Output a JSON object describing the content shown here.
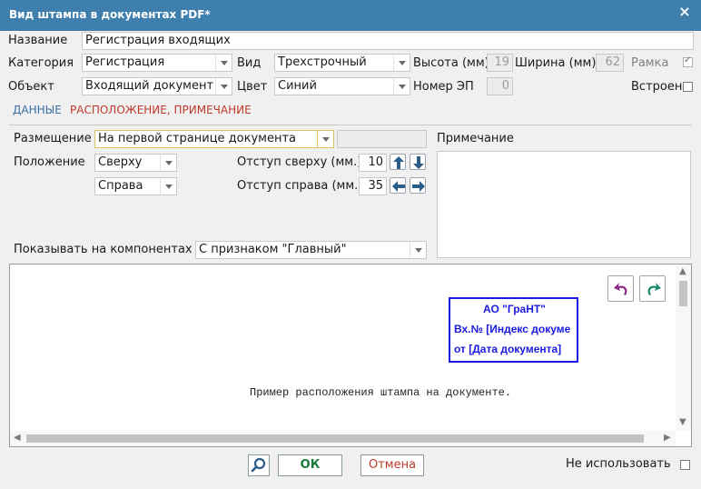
{
  "window": {
    "title": "Вид штампа в документах PDF*",
    "close_label": "×"
  },
  "fields": {
    "name_label": "Название",
    "name_value": "Регистрация входящих",
    "category_label": "Категория",
    "category_value": "Регистрация",
    "view_label": "Вид",
    "view_value": "Трехстрочный",
    "height_label": "Высота (мм)",
    "height_value": "19",
    "width_label": "Ширина (мм)",
    "width_value": "62",
    "frame_label": "Рамка",
    "frame_checked": true,
    "object_label": "Объект",
    "object_value": "Входящий документ",
    "color_label": "Цвет",
    "color_value": "Синий",
    "ep_label": "Номер ЭП",
    "ep_value": "0",
    "embedded_label": "Встроен",
    "embedded_checked": false
  },
  "tabs": [
    {
      "label": "ДАННЫЕ",
      "active": false
    },
    {
      "label": "РАСПОЛОЖЕНИЕ, ПРИМЕЧАНИЕ",
      "active": true
    }
  ],
  "placement": {
    "placement_label": "Размещение",
    "placement_value": "На первой странице документа",
    "position_label": "Положение",
    "vertical_value": "Сверху",
    "horizontal_value": "Справа",
    "offset_top_label": "Отступ сверху (мм.)",
    "offset_top_value": "10",
    "offset_right_label": "Отступ справа (мм.)",
    "offset_right_value": "35",
    "show_on_label": "Показывать на компонентах",
    "show_on_value": "С признаком \"Главный\"",
    "note_label": "Примечание"
  },
  "preview": {
    "stamp_lines": [
      "АО \"ГраНТ\"",
      "Вх.№ [Индекс докуме",
      "от  [Дата документа]"
    ],
    "sample_text": "Пример расположения штампа на документе.",
    "stamp_color": "#1a1ae0"
  },
  "footer": {
    "ok_label": "ОК",
    "cancel_label": "Отмена",
    "disable_label": "Не использовать",
    "disable_checked": false
  },
  "colors": {
    "titlebar": "#3f7fae",
    "tab_active": "#c0392b",
    "tab_inactive": "#3a6ea5"
  }
}
